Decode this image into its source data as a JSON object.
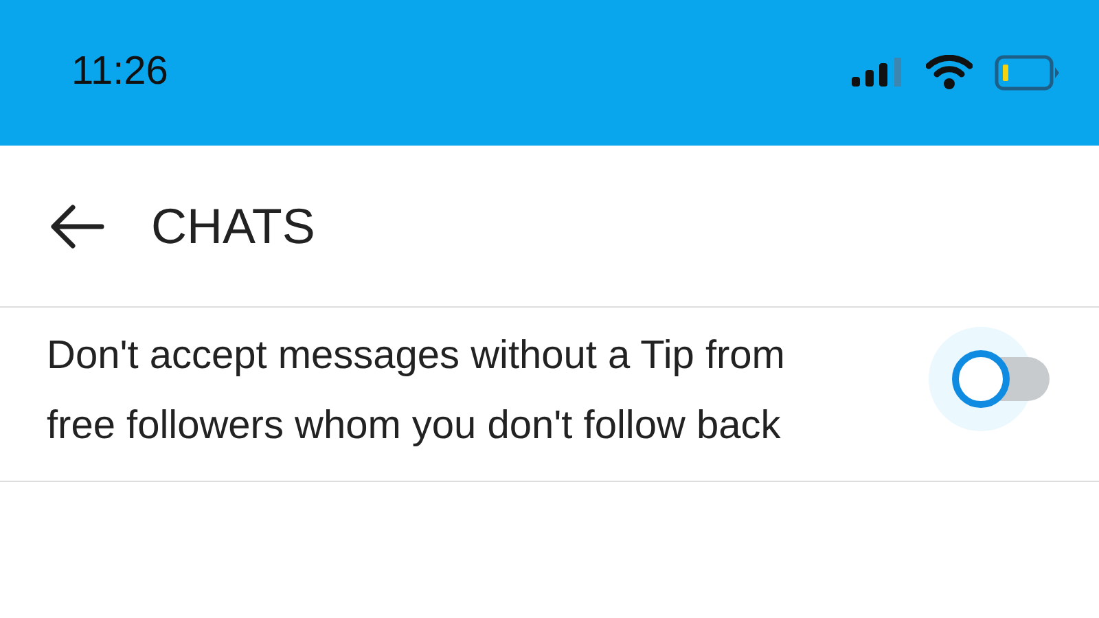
{
  "status_bar": {
    "time": "11:26"
  },
  "header": {
    "title": "CHATS"
  },
  "settings": [
    {
      "label": "Don't accept messages without a Tip from free followers whom you don't follow back",
      "on": false
    }
  ]
}
